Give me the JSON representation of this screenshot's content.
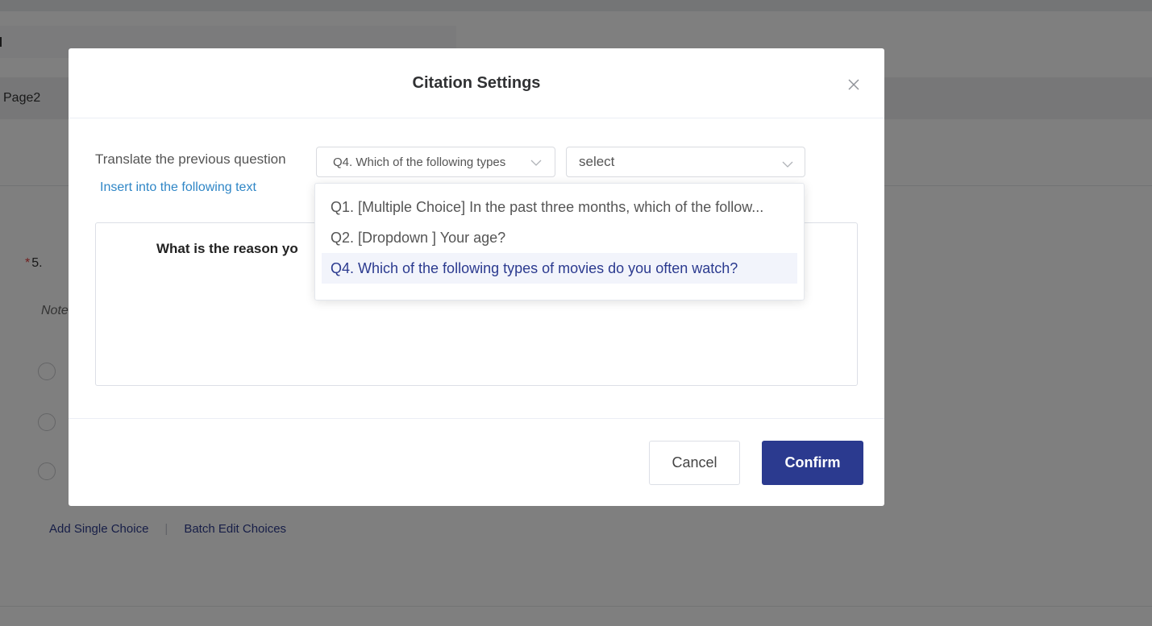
{
  "background": {
    "page_tab": "Page2",
    "question_number": "5.",
    "required_mark": "*",
    "note_label": "Note",
    "links": {
      "add_single_choice": "Add Single Choice",
      "batch_edit_choices": "Batch Edit Choices"
    }
  },
  "modal": {
    "title": "Citation Settings",
    "translate_label": "Translate the previous question",
    "insert_link": "Insert into the following text",
    "question_select_value": "Q4. Which of the following types",
    "option_select_placeholder": "select",
    "editor_text": "What is the reason yo",
    "cancel_label": "Cancel",
    "confirm_label": "Confirm"
  },
  "dropdown": {
    "items": [
      "Q1. [Multiple Choice] In the past three months, which of the follow...",
      "Q2. [Dropdown ] Your age?",
      "Q4. Which of the following types of movies do you often watch?"
    ],
    "selected_index": 2
  },
  "colors": {
    "primary": "#2b3a8f",
    "link": "#2f86c6",
    "required": "#e23c3c"
  }
}
